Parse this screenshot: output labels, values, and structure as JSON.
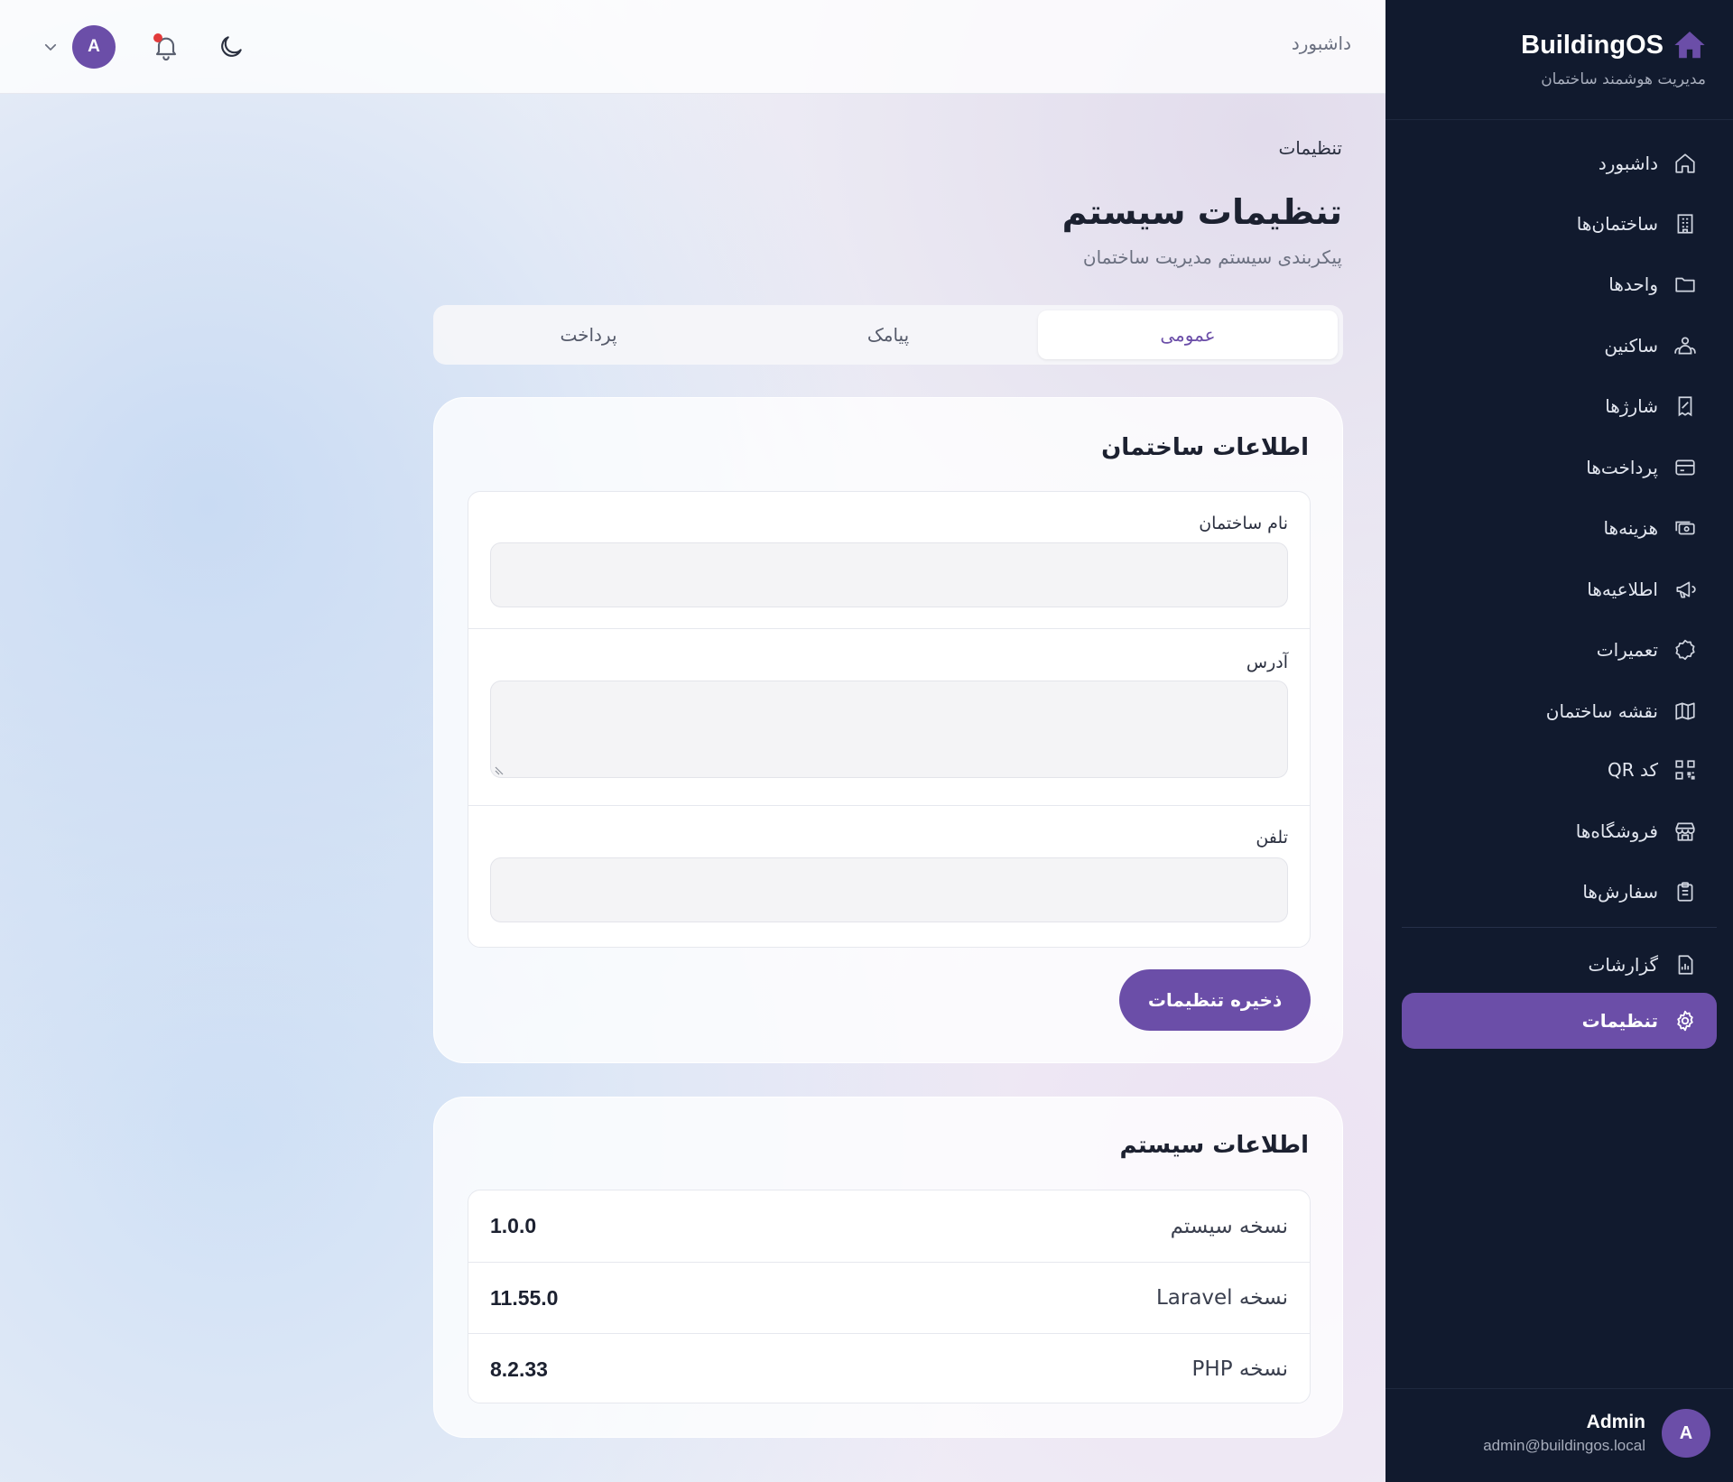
{
  "topbar": {
    "title": "داشبورد",
    "avatar_letter": "A"
  },
  "breadcrumb": "تنظیمات",
  "page": {
    "title": "تنظیمات سیستم",
    "subtitle": "پیکربندی سیستم مدیریت ساختمان"
  },
  "tabs": [
    {
      "label": "عمومی",
      "active": true
    },
    {
      "label": "پیامک",
      "active": false
    },
    {
      "label": "پرداخت",
      "active": false
    }
  ],
  "building_info": {
    "title": "اطلاعات ساختمان",
    "fields": {
      "name": {
        "label": "نام ساختمان",
        "value": ""
      },
      "address": {
        "label": "آدرس",
        "value": ""
      },
      "phone": {
        "label": "تلفن",
        "value": ""
      }
    },
    "save_label": "ذخیره تنظیمات"
  },
  "system_info": {
    "title": "اطلاعات سیستم",
    "rows": [
      {
        "key": "نسخه سیستم",
        "value": "1.0.0"
      },
      {
        "key": "نسخه Laravel",
        "value": "11.55.0"
      },
      {
        "key": "نسخه PHP",
        "value": "8.2.33"
      }
    ]
  },
  "sidebar": {
    "brand": "BuildingOS",
    "brand_subtitle": "مدیریت هوشمند ساختمان",
    "items": [
      {
        "label": "داشبورد",
        "icon": "home-icon"
      },
      {
        "label": "ساختمان‌ها",
        "icon": "building-icon"
      },
      {
        "label": "واحدها",
        "icon": "folder-icon"
      },
      {
        "label": "ساکنین",
        "icon": "residents-icon"
      },
      {
        "label": "شارژها",
        "icon": "receipt-icon"
      },
      {
        "label": "پرداخت‌ها",
        "icon": "credit-card-icon"
      },
      {
        "label": "هزینه‌ها",
        "icon": "cash-icon"
      },
      {
        "label": "اطلاعیه‌ها",
        "icon": "megaphone-icon"
      },
      {
        "label": "تعمیرات",
        "icon": "badge-icon"
      },
      {
        "label": "نقشه ساختمان",
        "icon": "map-icon"
      },
      {
        "label": "کد QR",
        "icon": "qr-code-icon"
      },
      {
        "label": "فروشگاه‌ها",
        "icon": "store-icon"
      },
      {
        "label": "سفارش‌ها",
        "icon": "clipboard-icon"
      },
      {
        "label": "گزارشات",
        "icon": "report-icon"
      },
      {
        "label": "تنظیمات",
        "icon": "gear-icon",
        "active": true
      }
    ],
    "user": {
      "avatar_letter": "A",
      "name": "Admin",
      "email": "admin@buildingos.local"
    }
  },
  "colors": {
    "accent": "#6b4ea8",
    "sidebar_bg": "#111a2e",
    "notification_dot": "#e23a3a"
  }
}
